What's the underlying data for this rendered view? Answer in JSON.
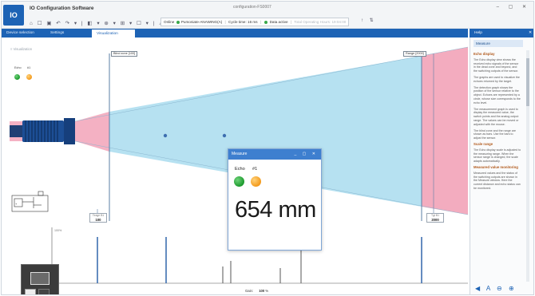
{
  "app": {
    "logo_text": "IO",
    "title": "IO Configuration Software",
    "window_title": "configuration-FS0007",
    "window_buttons": "– ▢ ✕",
    "quick_access": "⌂ ☐ ▣ ↶ ↷ ▾ | ◧ ▾ ⊕ ▾ ⊞ ▾ ☐ ▾ | ⚠ ⓘ"
  },
  "status": {
    "online_label": "Online",
    "device_label": "Pumoniate-ANAWING(A)",
    "cycle_label": "Cycle time: 16 ms",
    "data_label": "Data active",
    "faded_label": "Total Operating Hours: 19:04:00",
    "icons": "↑ ⇅"
  },
  "tabs": [
    {
      "label": "Device selection"
    },
    {
      "label": "Settings"
    },
    {
      "label": "Visualization"
    }
  ],
  "breadcrumb": "≡  Visualization",
  "echo_mini": {
    "echo_label": "Echo",
    "n1_label": "#1"
  },
  "markers": {
    "blind_zone": "Blind zone [100]",
    "range": "Range [2000]",
    "left_box": {
      "title": "Tirage B1",
      "value": "100"
    },
    "right_box": {
      "title": "Tgt B1",
      "value": "2000"
    }
  },
  "gain": {
    "label": "Gain:",
    "value": "100",
    "unit": "%"
  },
  "dialog": {
    "title": "Measure",
    "controls": "_ ▢ ✕",
    "echo_label": "Echo",
    "n1_label": "#1",
    "distance": "654 mm"
  },
  "sidepanel": {
    "header": "Help",
    "close": "✕",
    "title": "Measure",
    "sections": [
      {
        "heading": "Echo display",
        "paragraphs": [
          "The Echo display view shows the received echo signals of the sensor in the dead zone and beyond, and the switching outputs of the sensor.",
          "The graphs are used to visualize the echoes returned by the target.",
          "The detection graph shows the position of the sensor relative to the object. Echoes are represented by a circle, whose size corresponds to the echo level.",
          "The measurement graph is used to display the measured value, the switch points and the analog output range. The values can be moved or adjusted with the mouse.",
          "The blind zone and the range are shown as bars. Use the bars to adjust the sensor."
        ]
      },
      {
        "heading": "Scale range",
        "paragraphs": [
          "The Echo display scale is adjusted to the measuring range. When the sensor range is changed, the scale adapts automatically."
        ]
      },
      {
        "heading": "Measured value monitoring",
        "paragraphs": [
          "Measured values and the status of the switching outputs are shown in the Measure window. Here the current distance and echo status can be monitored."
        ]
      }
    ],
    "tools": "◀ A ⊖ ⊕"
  },
  "thumb": {
    "label": ""
  }
}
